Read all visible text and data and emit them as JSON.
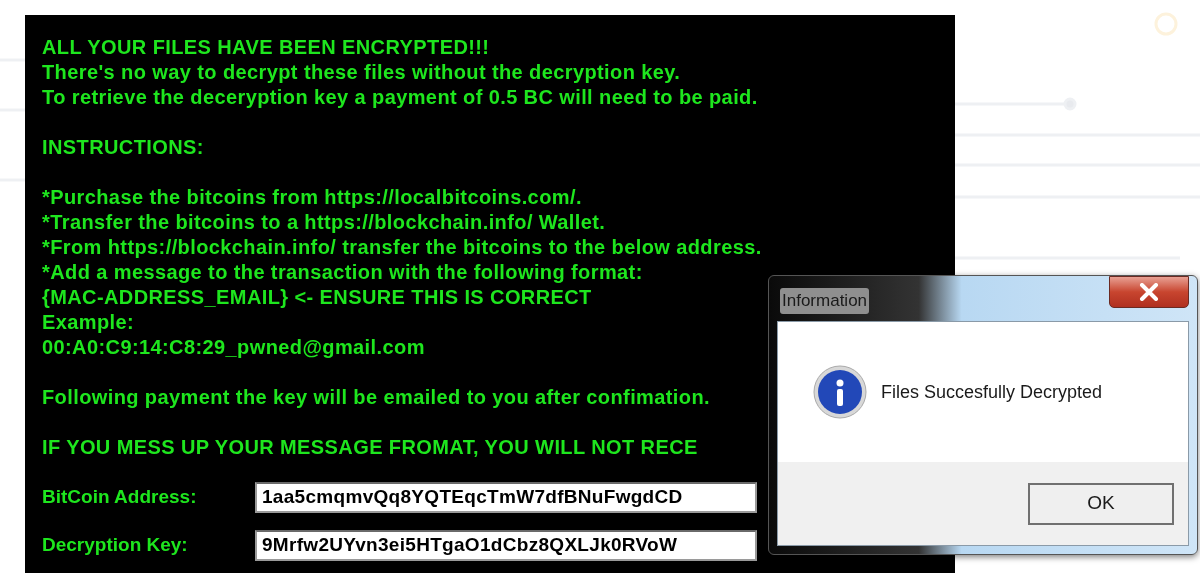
{
  "ransom_window": {
    "paragraphs": [
      [
        "ALL YOUR FILES HAVE BEEN ENCRYPTED!!!",
        "There's no way to decrypt these files without the decryption key.",
        "To retrieve the deceryption key a payment of 0.5 BC will need to be paid."
      ],
      [
        "INSTRUCTIONS:"
      ],
      [
        "*Purchase the bitcoins from https://localbitcoins.com/.",
        "*Transfer the bitcoins to a https://blockchain.info/ Wallet.",
        "*From https://blockchain.info/ transfer the bitcoins to the below address.",
        "*Add a message to the transaction with the following format:",
        "{MAC-ADDRESS_EMAIL} <- ENSURE THIS IS CORRECT",
        "Example:",
        "00:A0:C9:14:C8:29_pwned@gmail.com"
      ],
      [
        "Following payment the key will be emailed to you after confimation."
      ],
      [
        "IF YOU MESS UP YOUR MESSAGE FROMAT, YOU WILL NOT RECE"
      ]
    ],
    "fields": [
      {
        "label": "BitCoin Address:",
        "value": "1aa5cmqmvQq8YQTEqcTmW7dfBNuFwgdCD"
      },
      {
        "label": "Decryption Key:",
        "value": "9Mrfw2UYvn3ei5HTgaO1dCbz8QXLJk0RVoW"
      }
    ]
  },
  "dialog": {
    "title": "Information",
    "message": "Files Succesfully Decrypted",
    "button": "OK"
  }
}
